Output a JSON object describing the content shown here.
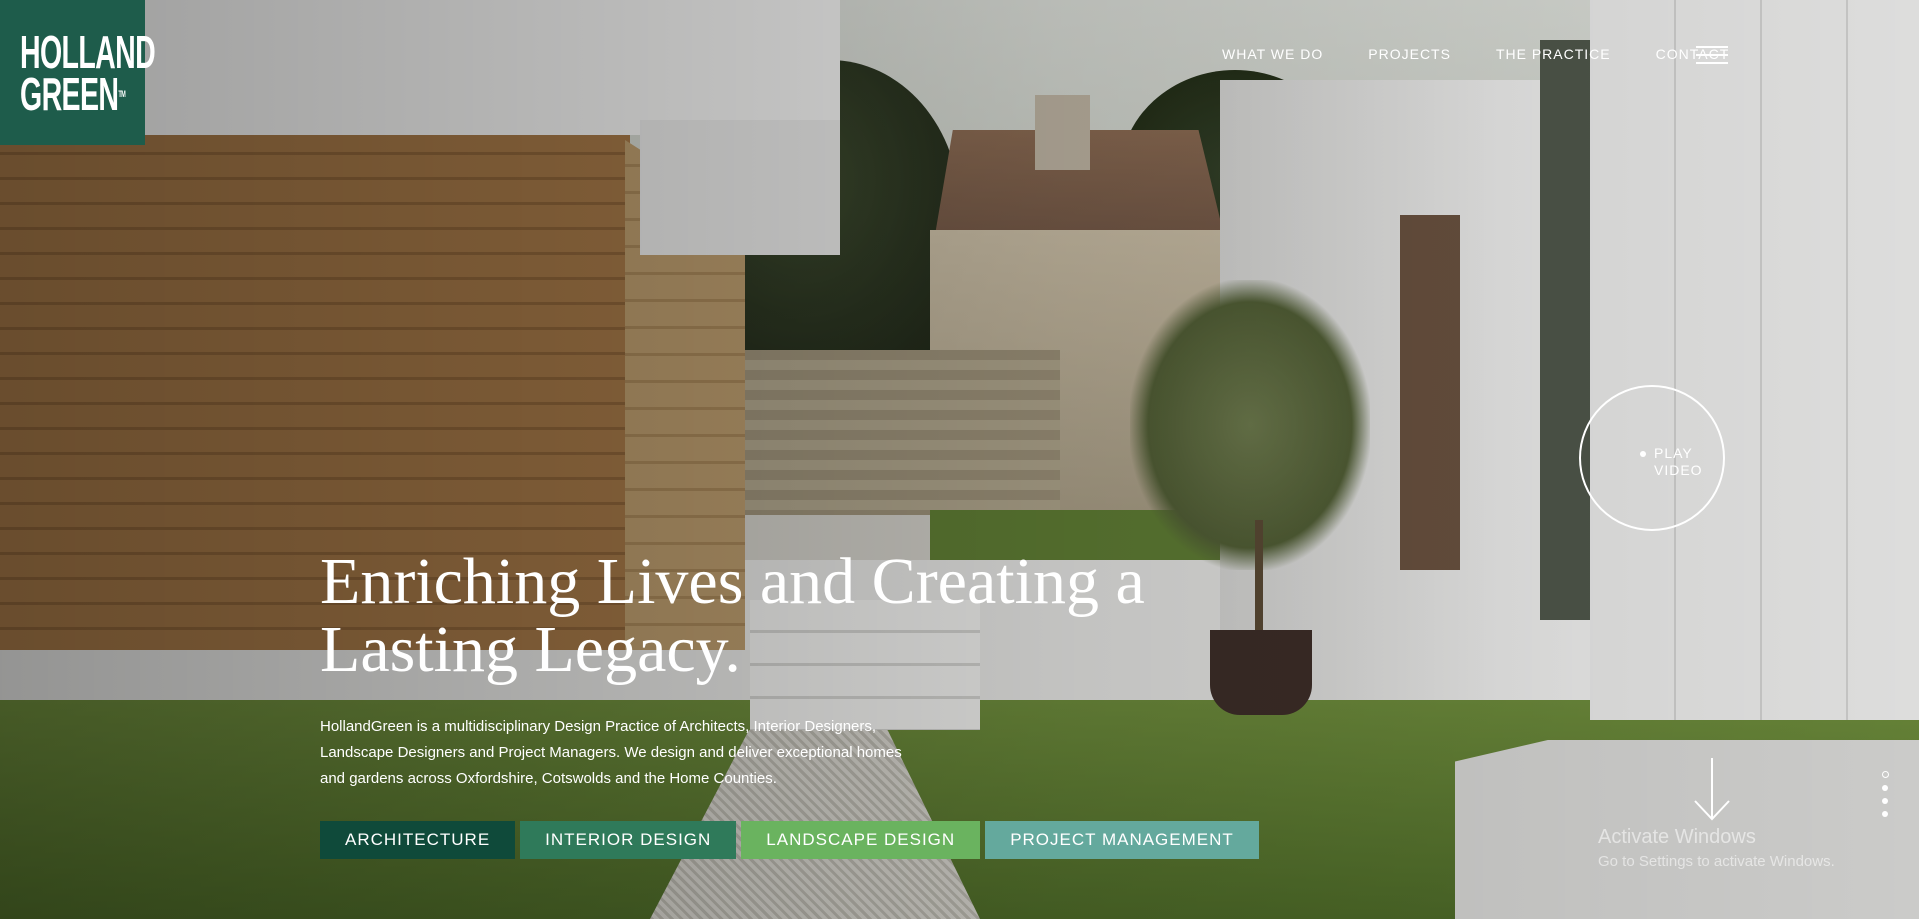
{
  "logo": {
    "line1": "HOLLAND",
    "line2": "GREEN",
    "tm": "TM"
  },
  "nav": {
    "items": [
      {
        "label": "WHAT WE DO"
      },
      {
        "label": "PROJECTS"
      },
      {
        "label": "THE PRACTICE"
      },
      {
        "label": "CONTACT"
      }
    ],
    "menu_icon": "hamburger-icon"
  },
  "play_video": {
    "line1": "PLAY",
    "line2": "VIDEO"
  },
  "hero": {
    "title": "Enriching Lives and Creating a Lasting Legacy.",
    "description": "HollandGreen is a multidisciplinary Design Practice of Architects, Interior Designers, Landscape Designers and Project Managers. We design and deliver exceptional homes and gardens across Oxfordshire, Cotswolds and the Home Counties."
  },
  "services": [
    {
      "label": "ARCHITECTURE",
      "color": "#0f4a3a"
    },
    {
      "label": "INTERIOR DESIGN",
      "color": "#2f7a5a"
    },
    {
      "label": "LANDSCAPE DESIGN",
      "color": "#6ab35f"
    },
    {
      "label": "PROJECT MANAGEMENT",
      "color": "#64a99d"
    }
  ],
  "scroll_icon": "arrow-down-icon",
  "windows_watermark": {
    "title": "Activate Windows",
    "subtitle": "Go to Settings to activate Windows."
  }
}
